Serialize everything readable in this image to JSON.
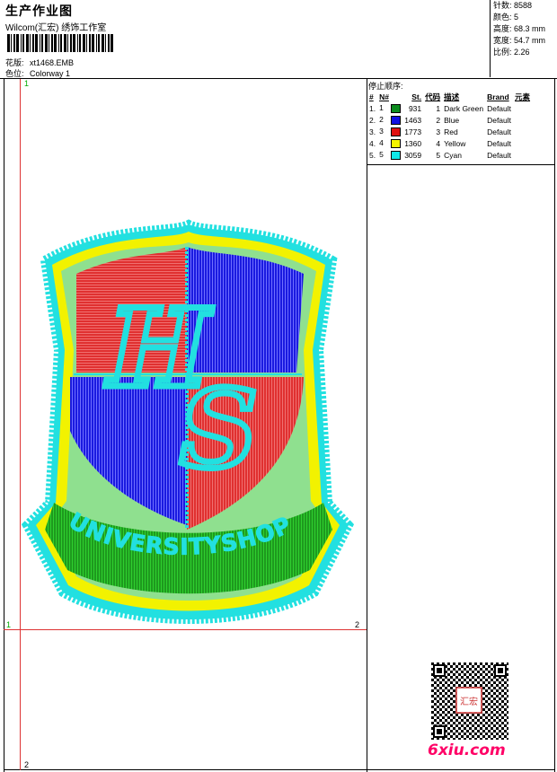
{
  "header": {
    "title": "生产作业图",
    "company": "Wilcom(汇宏) 绣饰工作室",
    "design_label": "花版:",
    "design_value": "xt1468.EMB",
    "colorway_label": "色位:",
    "colorway_value": "Colorway 1"
  },
  "stats": [
    {
      "label": "针数:",
      "value": "8588"
    },
    {
      "label": "颜色:",
      "value": "5"
    },
    {
      "label": "高度:",
      "value": "68.3 mm"
    },
    {
      "label": "宽度:",
      "value": "54.7 mm"
    },
    {
      "label": "比例:",
      "value": "2.26"
    }
  ],
  "stop_sequence_label": "停止顺序:",
  "thread_table": {
    "headers": [
      "#",
      "N#",
      "St.",
      "代码",
      "描述",
      "Brand",
      "元素"
    ],
    "rows": [
      {
        "idx": "1.",
        "n": "1",
        "color": "#0b8c1e",
        "st": "931",
        "code": "1",
        "desc": "Dark Green",
        "brand": "Default"
      },
      {
        "idx": "2.",
        "n": "2",
        "color": "#1010e0",
        "st": "1463",
        "code": "2",
        "desc": "Blue",
        "brand": "Default"
      },
      {
        "idx": "3.",
        "n": "3",
        "color": "#e01010",
        "st": "1773",
        "code": "3",
        "desc": "Red",
        "brand": "Default"
      },
      {
        "idx": "4.",
        "n": "4",
        "color": "#f5f500",
        "st": "1360",
        "code": "4",
        "desc": "Yellow",
        "brand": "Default"
      },
      {
        "idx": "5.",
        "n": "5",
        "color": "#10e8e8",
        "st": "3059",
        "code": "5",
        "desc": "Cyan",
        "brand": "Default"
      }
    ]
  },
  "design": {
    "banner_text": "UNIVERSITYSHOP",
    "monogram": "HS",
    "colors": {
      "green": "#1e9a1e",
      "blue": "#1a1ae0",
      "red": "#e03030",
      "yellow": "#f2f200",
      "cyan": "#22e0e0"
    }
  },
  "axis_labels": {
    "top_left": "1",
    "left_mid": "1",
    "right_mid": "2",
    "bottom_left": "2"
  },
  "watermark": "6xiu.com",
  "qr_stamp": "汇宏"
}
